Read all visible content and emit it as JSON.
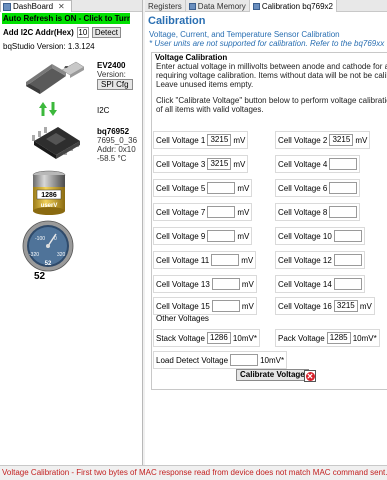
{
  "dashboard": {
    "tab_label": "DashBoard",
    "auto_refresh": "Auto Refresh is ON - Click to Turn OFF",
    "i2c_addr_label": "Add I2C Addr(Hex)",
    "i2c_addr_value": "10",
    "detect_label": "Detect",
    "studio_version": "bqStudio Version:   1.3.124",
    "ev": {
      "name": "EV2400",
      "version": "Version: 0.32",
      "spi_label": "SPI Cfg"
    },
    "i2c_label": "I2C",
    "device": {
      "name": "bq76952",
      "id": "7695_0_36",
      "addr": "Addr: 0x10",
      "temp": "-58.5 °C"
    },
    "battery_text": "1286",
    "battery_unit": "userV",
    "gauge": {
      "value": "52",
      "label": "52",
      "ticks": [
        "-100",
        "0",
        "-320",
        "320"
      ]
    }
  },
  "tabs": [
    {
      "label": "Registers"
    },
    {
      "label": "Data Memory"
    },
    {
      "label": "Calibration bq769x2"
    }
  ],
  "calibration": {
    "title": "Calibration",
    "subtitle": "Voltage, Current, and Temperature Sensor Calibration",
    "warning": "* User units are not supported for calibration. Refer to the bq769xx User",
    "voltage_section_title": "Voltage Calibration",
    "desc_line1": "Enter actual voltage in millivolts between anode and cathode for any cell",
    "desc_line2": "requiring voltage calibration.  Items without data will be not be calibrate",
    "desc_line3": "Leave unused items empty.",
    "desc_line4": "Click \"Calibrate Voltage\" button below to perform voltage calibration",
    "desc_line5": "of all items with valid voltages.",
    "unit": "mV",
    "cells": [
      {
        "label": "Cell Voltage 1",
        "value": "3215"
      },
      {
        "label": "Cell Voltage 2",
        "value": "3215"
      },
      {
        "label": "Cell Voltage 3",
        "value": "3215"
      },
      {
        "label": "Cell Voltage 4",
        "value": ""
      },
      {
        "label": "Cell Voltage 5",
        "value": ""
      },
      {
        "label": "Cell Voltage 6",
        "value": ""
      },
      {
        "label": "Cell Voltage 7",
        "value": ""
      },
      {
        "label": "Cell Voltage 8",
        "value": ""
      },
      {
        "label": "Cell Voltage 9",
        "value": ""
      },
      {
        "label": "Cell Voltage 10",
        "value": ""
      },
      {
        "label": "Cell Voltage 11",
        "value": ""
      },
      {
        "label": "Cell Voltage 12",
        "value": ""
      },
      {
        "label": "Cell Voltage 13",
        "value": ""
      },
      {
        "label": "Cell Voltage 14",
        "value": ""
      },
      {
        "label": "Cell Voltage 15",
        "value": ""
      },
      {
        "label": "Cell Voltage 16",
        "value": "3215"
      }
    ],
    "other_voltages_label": "Other Voltages",
    "stack": {
      "label": "Stack Voltage",
      "value": "1286",
      "unit": "10mV*"
    },
    "pack": {
      "label": "Pack Voltage",
      "value": "1285",
      "unit": "10mV*"
    },
    "load_detect": {
      "label": "Load Detect Voltage",
      "value": "",
      "unit": "10mV*"
    },
    "calibrate_button": "Calibrate Voltage"
  },
  "status_message": "Voltage Calibration - First two bytes of MAC response read from device does not match MAC command sent.",
  "colors": {
    "accent_blue": "#2a6fb2",
    "auto_refresh_green": "#00e000",
    "status_red": "#c21f1f"
  }
}
